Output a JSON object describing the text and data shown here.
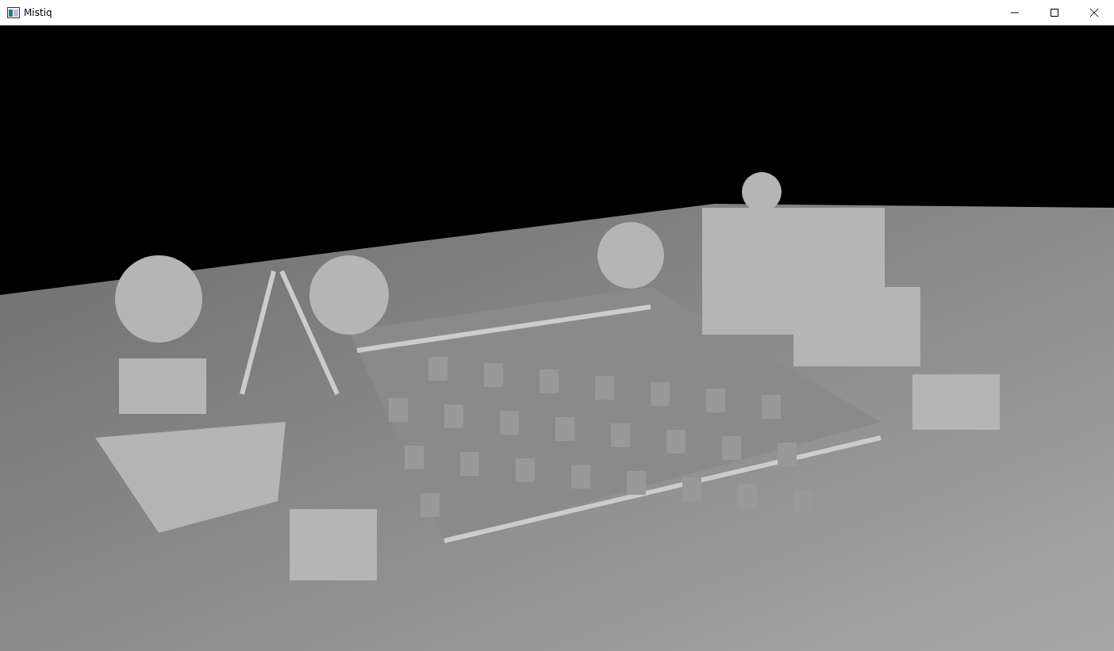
{
  "window": {
    "title": "Mistiq"
  }
}
